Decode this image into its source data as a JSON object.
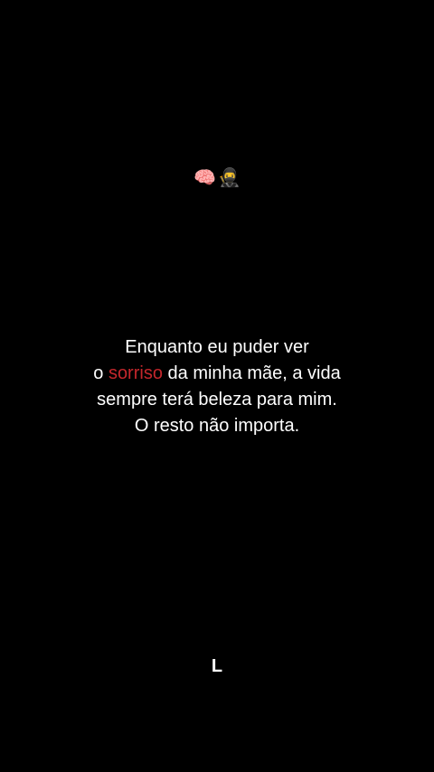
{
  "emojis": {
    "brain": "🧠",
    "ninja": "🥷"
  },
  "quote": {
    "line1": "Enquanto eu puder ver",
    "line2_prefix": "o ",
    "line2_highlight": "sorriso",
    "line2_suffix": " da minha mãe, a vida",
    "line3": "sempre terá beleza para mim.",
    "line4": "O resto não importa."
  },
  "signature": "L",
  "colors": {
    "background": "#000000",
    "text": "#ffffff",
    "highlight": "#c4272c"
  }
}
